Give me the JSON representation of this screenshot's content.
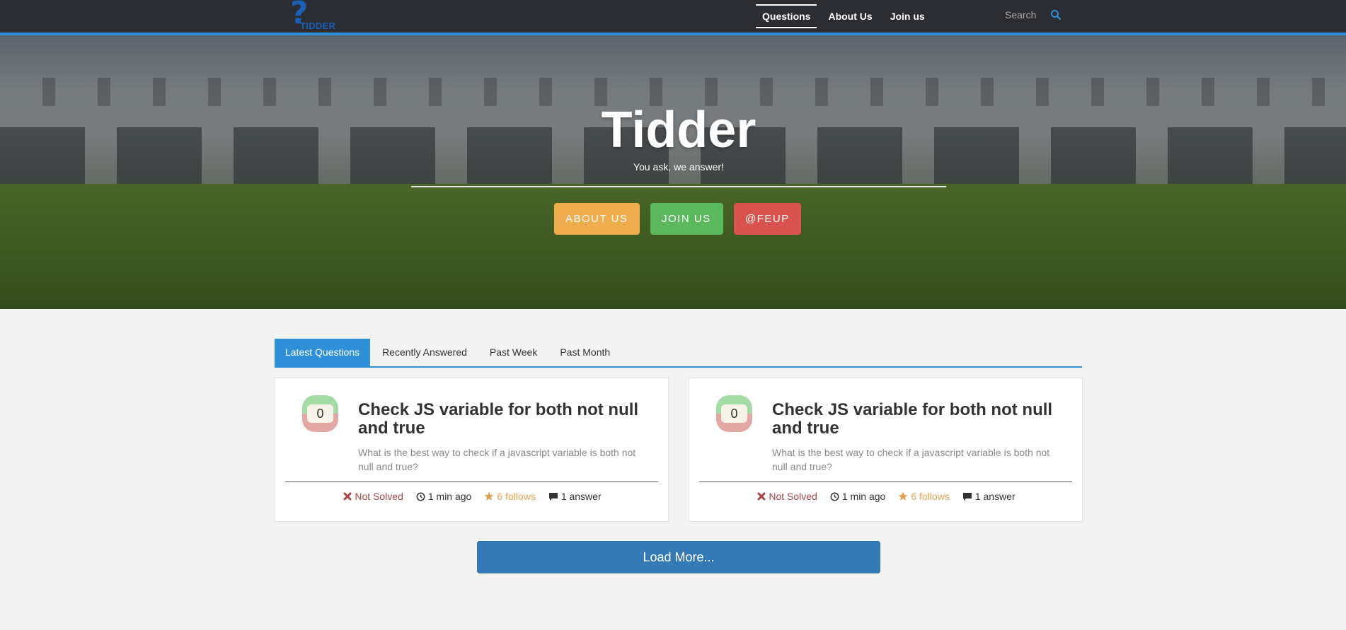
{
  "nav": {
    "logo_text": "TIDDER",
    "links": [
      {
        "label": "Questions",
        "active": true
      },
      {
        "label": "About Us",
        "active": false
      },
      {
        "label": "Join us",
        "active": false
      }
    ],
    "search_placeholder": "Search"
  },
  "hero": {
    "title": "Tidder",
    "subtitle": "You ask, we answer!",
    "buttons": {
      "about": "ABOUT US",
      "join": "JOIN US",
      "feup": "@FEUP"
    }
  },
  "tabs": [
    {
      "label": "Latest Questions",
      "active": true
    },
    {
      "label": "Recently Answered",
      "active": false
    },
    {
      "label": "Past Week",
      "active": false
    },
    {
      "label": "Past Month",
      "active": false
    }
  ],
  "questions": [
    {
      "votes": "0",
      "title": "Check JS variable for both not null and true",
      "description": "What is the best way to check if a javascript variable is both not null and true?",
      "status": "Not Solved",
      "time": "1 min ago",
      "follows": "6 follows",
      "answers": "1 answer"
    },
    {
      "votes": "0",
      "title": "Check JS variable for both not null and true",
      "description": "What is the best way to check if a javascript variable is both not null and true?",
      "status": "Not Solved",
      "time": "1 min ago",
      "follows": "6 follows",
      "answers": "1 answer"
    }
  ],
  "load_more_label": "Load More...",
  "colors": {
    "navbar": "#2b2d33",
    "accent": "#2f8fd8",
    "about_btn": "#f0ad4e",
    "join_btn": "#5cb85c",
    "feup_btn": "#d9534f",
    "load_more": "#337ab7"
  }
}
